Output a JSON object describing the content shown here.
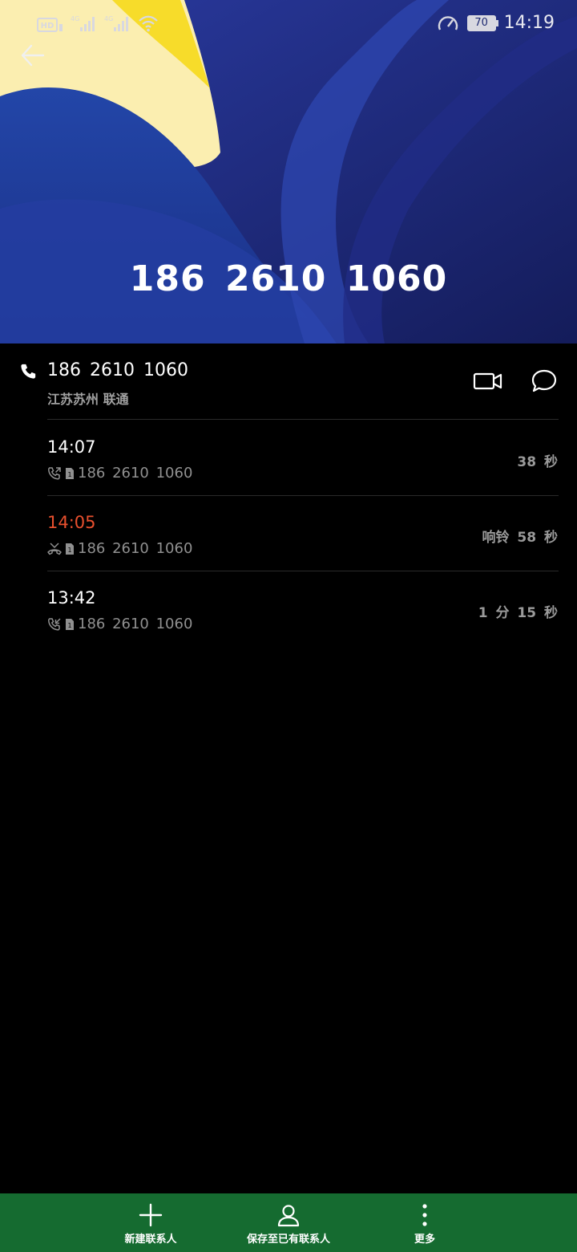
{
  "status_bar": {
    "network_icons": [
      "hd-icon",
      "4g-signal-icon",
      "4g-signal-icon",
      "wifi-icon"
    ],
    "battery_level": "70",
    "time": "14:19"
  },
  "header": {
    "phone_number": "186 2610 1060"
  },
  "contact": {
    "number": "186 2610 1060",
    "location": "江苏苏州 联通"
  },
  "call_log": [
    {
      "time": "14:07",
      "type": "outgoing",
      "number": "186 2610 1060",
      "duration": "38 秒"
    },
    {
      "time": "14:05",
      "type": "missed",
      "number": "186 2610 1060",
      "duration": "响铃 58 秒"
    },
    {
      "time": "13:42",
      "type": "incoming",
      "number": "186 2610 1060",
      "duration": "1 分 15 秒"
    }
  ],
  "bottom_bar": {
    "new_contact": "新建联系人",
    "save_existing": "保存至已有联系人",
    "more": "更多"
  },
  "colors": {
    "missed": "#e9502e",
    "bottom_bar": "#156b30",
    "header_bg": "#1c2870"
  }
}
